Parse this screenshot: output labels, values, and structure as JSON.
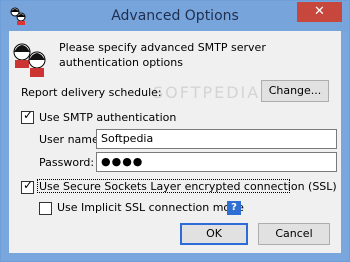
{
  "window": {
    "title": "Advanced Options",
    "close_label": "✕"
  },
  "header": {
    "description": "Please specify advanced SMTP server authentication options"
  },
  "schedule": {
    "label": "Report delivery schedule:",
    "change_label": "Change..."
  },
  "smtp_auth": {
    "checkbox_label": "Use SMTP authentication",
    "checked": true,
    "username_label": "User name:",
    "username_value": "Softpedia",
    "password_label": "Password:",
    "password_value": "●●●●"
  },
  "ssl": {
    "checkbox_label": "Use Secure Sockets Layer encrypted connection (SSL)",
    "checked": true,
    "implicit_label": "Use Implicit SSL connection mode",
    "implicit_checked": false,
    "help_label": "?"
  },
  "buttons": {
    "ok_label": "OK",
    "cancel_label": "Cancel"
  },
  "watermark": "SOFTPEDIA"
}
